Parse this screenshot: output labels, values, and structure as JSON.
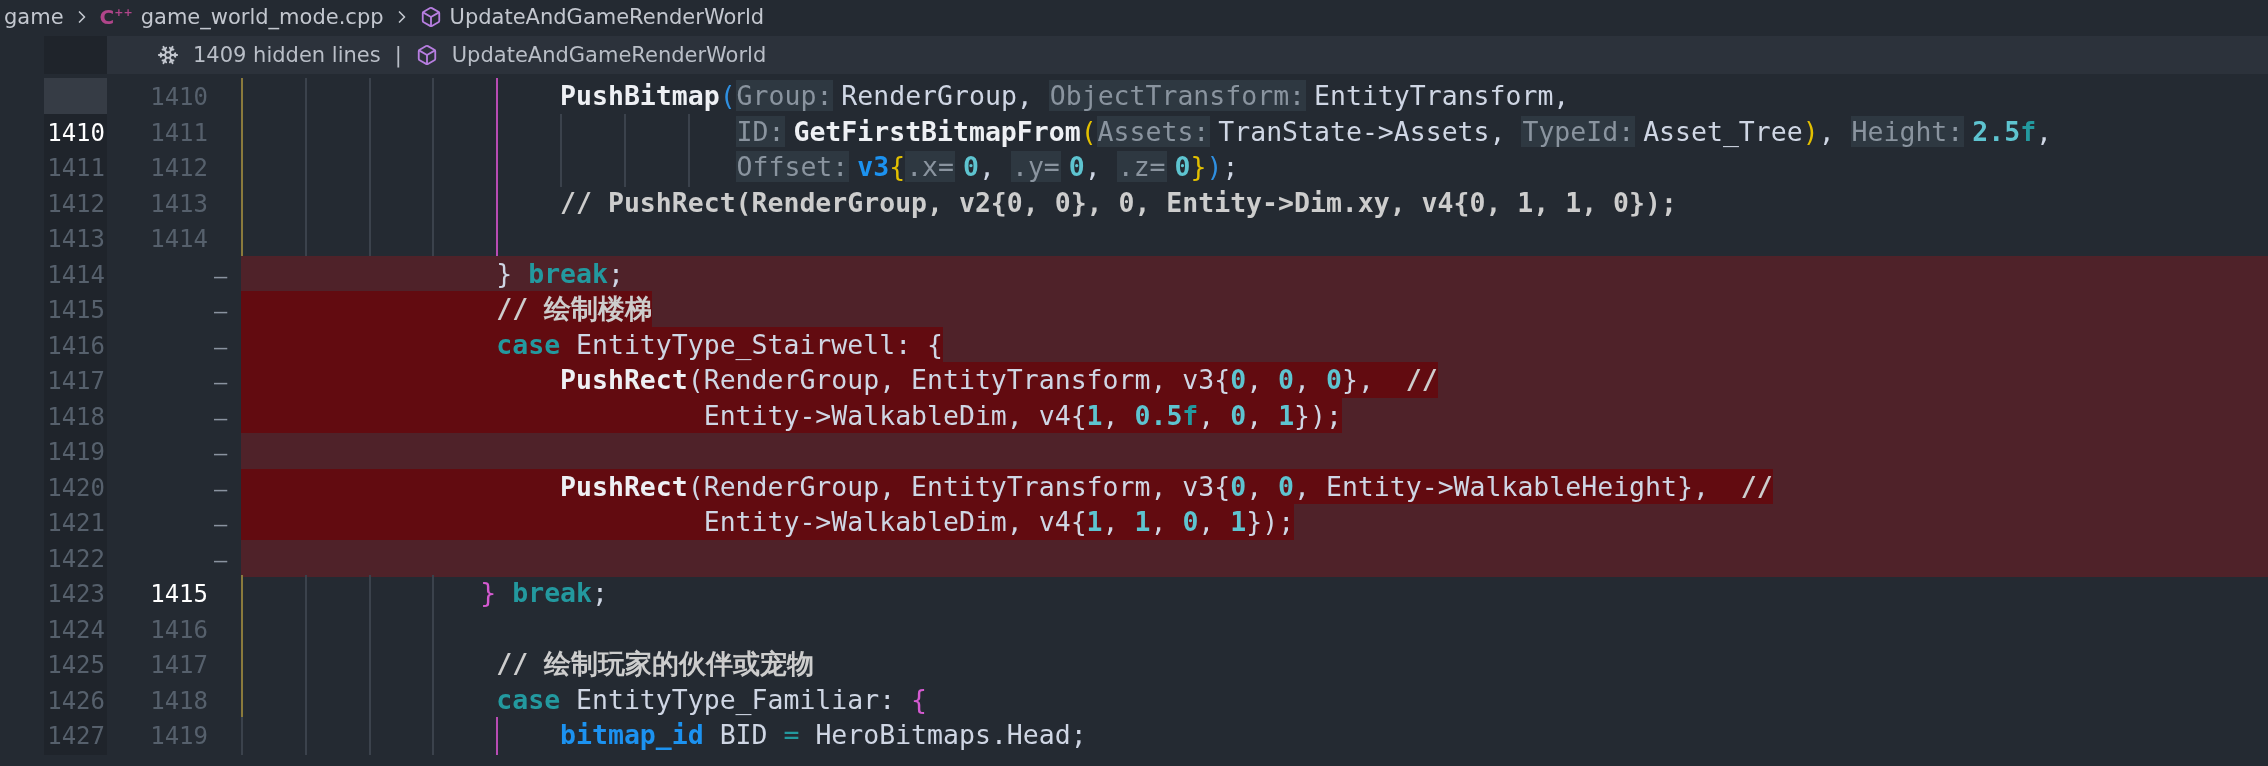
{
  "breadcrumb": {
    "items": [
      {
        "kind": "folder",
        "label": "game"
      },
      {
        "kind": "file",
        "icon_text": "C$^{++}$",
        "label": "game_world_mode.cpp"
      },
      {
        "kind": "symbol",
        "label": "UpdateAndGameRenderWorld"
      }
    ]
  },
  "hidden_lines": {
    "label": "1409 hidden lines",
    "separator": "|",
    "symbol": "UpdateAndGameRenderWorld"
  },
  "rows": [
    {
      "kind": "context",
      "new_number": "1410",
      "new_active": false,
      "guides": [
        {
          "kind": "outer"
        },
        {
          "kind": "plain"
        },
        {
          "kind": "plain"
        },
        {
          "kind": "plain"
        },
        {
          "kind": "scope"
        }
      ],
      "tokens": [
        {
          "kind": "function",
          "text": "                    PushBitmap"
        },
        {
          "kind": "bracket",
          "color": "#2f8fe0",
          "text": "("
        },
        {
          "kind": "hint",
          "text": "Group:"
        },
        {
          "kind": "text",
          "text": "RenderGroup, "
        },
        {
          "kind": "hint",
          "text": "ObjectTransform:"
        },
        {
          "kind": "text",
          "text": "EntityTransform,"
        }
      ]
    },
    {
      "kind": "context",
      "old_number": "1410",
      "new_number": "1411",
      "old_active": true,
      "new_active": false,
      "guides": [
        {
          "kind": "outer"
        },
        {
          "kind": "plain"
        },
        {
          "kind": "plain"
        },
        {
          "kind": "plain"
        },
        {
          "kind": "scope"
        },
        {
          "kind": "plain"
        },
        {
          "kind": "plain"
        },
        {
          "kind": "plain"
        }
      ],
      "tokens": [
        {
          "kind": "hint",
          "text": "ID:"
        },
        {
          "kind": "function",
          "text": "GetFirstBitmapFrom"
        },
        {
          "kind": "bracket",
          "color": "#e3c000",
          "text": "("
        },
        {
          "kind": "hint",
          "text": "Assets:"
        },
        {
          "kind": "text",
          "text": "TranState->Assets, "
        },
        {
          "kind": "hint",
          "text": "TypeId:"
        },
        {
          "kind": "text",
          "text": "Asset_Tree"
        },
        {
          "kind": "bracket",
          "color": "#e3c000",
          "text": ")"
        },
        {
          "kind": "text",
          "text": ", "
        },
        {
          "kind": "hint",
          "text": "Height:"
        },
        {
          "kind": "number",
          "text": "2.5"
        },
        {
          "kind": "suffix",
          "text": "f"
        },
        {
          "kind": "text",
          "text": ","
        }
      ]
    },
    {
      "kind": "context",
      "old_number": "1411",
      "new_number": "1412",
      "old_active": false,
      "new_active": false,
      "guides": [
        {
          "kind": "outer"
        },
        {
          "kind": "plain"
        },
        {
          "kind": "plain"
        },
        {
          "kind": "plain"
        },
        {
          "kind": "scope"
        },
        {
          "kind": "plain"
        },
        {
          "kind": "plain"
        },
        {
          "kind": "plain"
        }
      ],
      "tokens": [
        {
          "kind": "hint",
          "text": "Offset:"
        },
        {
          "kind": "type",
          "text": "v3"
        },
        {
          "kind": "bracket",
          "color": "#e3c000",
          "text": "{"
        },
        {
          "kind": "hint",
          "text": ".x="
        },
        {
          "kind": "number",
          "text": "0"
        },
        {
          "kind": "text",
          "text": ", "
        },
        {
          "kind": "hint",
          "text": ".y="
        },
        {
          "kind": "number",
          "text": "0"
        },
        {
          "kind": "text",
          "text": ", "
        },
        {
          "kind": "hint",
          "text": ".z="
        },
        {
          "kind": "number",
          "text": "0"
        },
        {
          "kind": "bracket",
          "color": "#e3c000",
          "text": "}"
        },
        {
          "kind": "bracket",
          "color": "#2f8fe0",
          "text": ")"
        },
        {
          "kind": "text",
          "text": ";"
        }
      ]
    },
    {
      "kind": "context",
      "old_number": "1412",
      "new_number": "1413",
      "old_active": false,
      "new_active": false,
      "guides": [
        {
          "kind": "outer"
        },
        {
          "kind": "plain"
        },
        {
          "kind": "plain"
        },
        {
          "kind": "plain"
        },
        {
          "kind": "scope"
        }
      ],
      "tokens": [
        {
          "kind": "comment",
          "text": "                    // PushRect(RenderGroup, v2{0, 0}, 0, Entity->Dim.xy, v4{0, 1, 1, 0});"
        }
      ]
    },
    {
      "kind": "context",
      "old_number": "1413",
      "new_number": "1414",
      "old_active": false,
      "new_active": false,
      "guides": [
        {
          "kind": "outer"
        },
        {
          "kind": "plain"
        },
        {
          "kind": "plain"
        },
        {
          "kind": "plain"
        },
        {
          "kind": "scope"
        }
      ],
      "tokens": []
    },
    {
      "kind": "removed",
      "old_number": "1414",
      "new_number": "—",
      "old_active": false,
      "changed_text": false,
      "tokens": [
        {
          "kind": "text",
          "text": "                } "
        },
        {
          "kind": "keyword",
          "text": "break"
        },
        {
          "kind": "text",
          "text": ";"
        }
      ]
    },
    {
      "kind": "removed",
      "old_number": "1415",
      "new_number": "—",
      "old_active": false,
      "changed_text": true,
      "tokens": [
        {
          "kind": "comment",
          "text": "                // 绘制楼梯"
        }
      ]
    },
    {
      "kind": "removed",
      "old_number": "1416",
      "new_number": "—",
      "old_active": false,
      "changed_text": true,
      "tokens": [
        {
          "kind": "keyword",
          "text": "                case"
        },
        {
          "kind": "text",
          "text": " EntityType_Stairwell: {"
        }
      ]
    },
    {
      "kind": "removed",
      "old_number": "1417",
      "new_number": "—",
      "old_active": false,
      "changed_text": true,
      "tokens": [
        {
          "kind": "function",
          "text": "                    PushRect"
        },
        {
          "kind": "text",
          "text": "(RenderGroup, EntityTransform, v3{"
        },
        {
          "kind": "number",
          "text": "0"
        },
        {
          "kind": "text",
          "text": ", "
        },
        {
          "kind": "number",
          "text": "0"
        },
        {
          "kind": "text",
          "text": ", "
        },
        {
          "kind": "number",
          "text": "0"
        },
        {
          "kind": "text",
          "text": "},  "
        },
        {
          "kind": "comment",
          "text": "//"
        }
      ]
    },
    {
      "kind": "removed",
      "old_number": "1418",
      "new_number": "—",
      "old_active": false,
      "changed_text": true,
      "tokens": [
        {
          "kind": "text",
          "text": "                             Entity->WalkableDim, v4{"
        },
        {
          "kind": "number",
          "text": "1"
        },
        {
          "kind": "text",
          "text": ", "
        },
        {
          "kind": "number",
          "text": "0.5"
        },
        {
          "kind": "suffix",
          "text": "f"
        },
        {
          "kind": "text",
          "text": ", "
        },
        {
          "kind": "number",
          "text": "0"
        },
        {
          "kind": "text",
          "text": ", "
        },
        {
          "kind": "number",
          "text": "1"
        },
        {
          "kind": "text",
          "text": "});"
        }
      ]
    },
    {
      "kind": "removed",
      "old_number": "1419",
      "new_number": "—",
      "old_active": false,
      "tokens": []
    },
    {
      "kind": "removed",
      "old_number": "1420",
      "new_number": "—",
      "old_active": false,
      "changed_text": true,
      "tokens": [
        {
          "kind": "function",
          "text": "                    PushRect"
        },
        {
          "kind": "text",
          "text": "(RenderGroup, EntityTransform, v3{"
        },
        {
          "kind": "number",
          "text": "0"
        },
        {
          "kind": "text",
          "text": ", "
        },
        {
          "kind": "number",
          "text": "0"
        },
        {
          "kind": "text",
          "text": ", Entity->WalkableHeight},  "
        },
        {
          "kind": "comment",
          "text": "//"
        }
      ]
    },
    {
      "kind": "removed",
      "old_number": "1421",
      "new_number": "—",
      "old_active": false,
      "changed_text": true,
      "tokens": [
        {
          "kind": "text",
          "text": "                             Entity->WalkableDim, v4{"
        },
        {
          "kind": "number",
          "text": "1"
        },
        {
          "kind": "text",
          "text": ", "
        },
        {
          "kind": "number",
          "text": "1"
        },
        {
          "kind": "text",
          "text": ", "
        },
        {
          "kind": "number",
          "text": "0"
        },
        {
          "kind": "text",
          "text": ", "
        },
        {
          "kind": "number",
          "text": "1"
        },
        {
          "kind": "text",
          "text": "});"
        }
      ]
    },
    {
      "kind": "removed",
      "old_number": "1422",
      "new_number": "—",
      "old_active": false,
      "tokens": []
    },
    {
      "kind": "context",
      "old_number": "1423",
      "new_number": "1415",
      "old_active": false,
      "new_active": true,
      "guides": [
        {
          "kind": "outer"
        },
        {
          "kind": "plain"
        },
        {
          "kind": "plain"
        },
        {
          "kind": "plain"
        }
      ],
      "tokens": [
        {
          "kind": "bracket",
          "color": "#d45ad0",
          "text": "}"
        },
        {
          "kind": "keyword",
          "text": " break"
        },
        {
          "kind": "text",
          "text": ";"
        }
      ]
    },
    {
      "kind": "context",
      "old_number": "1424",
      "new_number": "1416",
      "old_active": false,
      "new_active": false,
      "guides": [
        {
          "kind": "outer"
        },
        {
          "kind": "plain"
        },
        {
          "kind": "plain"
        },
        {
          "kind": "plain"
        }
      ],
      "tokens": []
    },
    {
      "kind": "context",
      "old_number": "1425",
      "new_number": "1417",
      "old_active": false,
      "new_active": false,
      "guides": [
        {
          "kind": "outer"
        },
        {
          "kind": "plain"
        },
        {
          "kind": "plain"
        },
        {
          "kind": "plain"
        }
      ],
      "tokens": [
        {
          "kind": "comment",
          "text": "                // 绘制玩家的伙伴或宠物"
        }
      ]
    },
    {
      "kind": "context",
      "old_number": "1426",
      "new_number": "1418",
      "old_active": false,
      "new_active": false,
      "guides": [
        {
          "kind": "outer"
        },
        {
          "kind": "plain"
        },
        {
          "kind": "plain"
        },
        {
          "kind": "plain"
        }
      ],
      "tokens": [
        {
          "kind": "keyword",
          "text": "                case"
        },
        {
          "kind": "text",
          "text": " EntityType_Familiar: "
        },
        {
          "kind": "bracket",
          "color": "#d45ad0",
          "text": "{"
        }
      ]
    },
    {
      "kind": "context",
      "old_number": "1427",
      "new_number": "1419",
      "old_active": false,
      "new_active": false,
      "guides": [
        {
          "kind": "plain"
        },
        {
          "kind": "plain"
        },
        {
          "kind": "plain"
        },
        {
          "kind": "plain"
        },
        {
          "kind": "scope"
        }
      ],
      "tokens": [
        {
          "kind": "type",
          "text": "                    bitmap_id"
        },
        {
          "kind": "text",
          "text": " BID "
        },
        {
          "kind": "operator",
          "text": "="
        },
        {
          "kind": "text",
          "text": " HeroBitmaps.Head;"
        }
      ]
    }
  ]
}
